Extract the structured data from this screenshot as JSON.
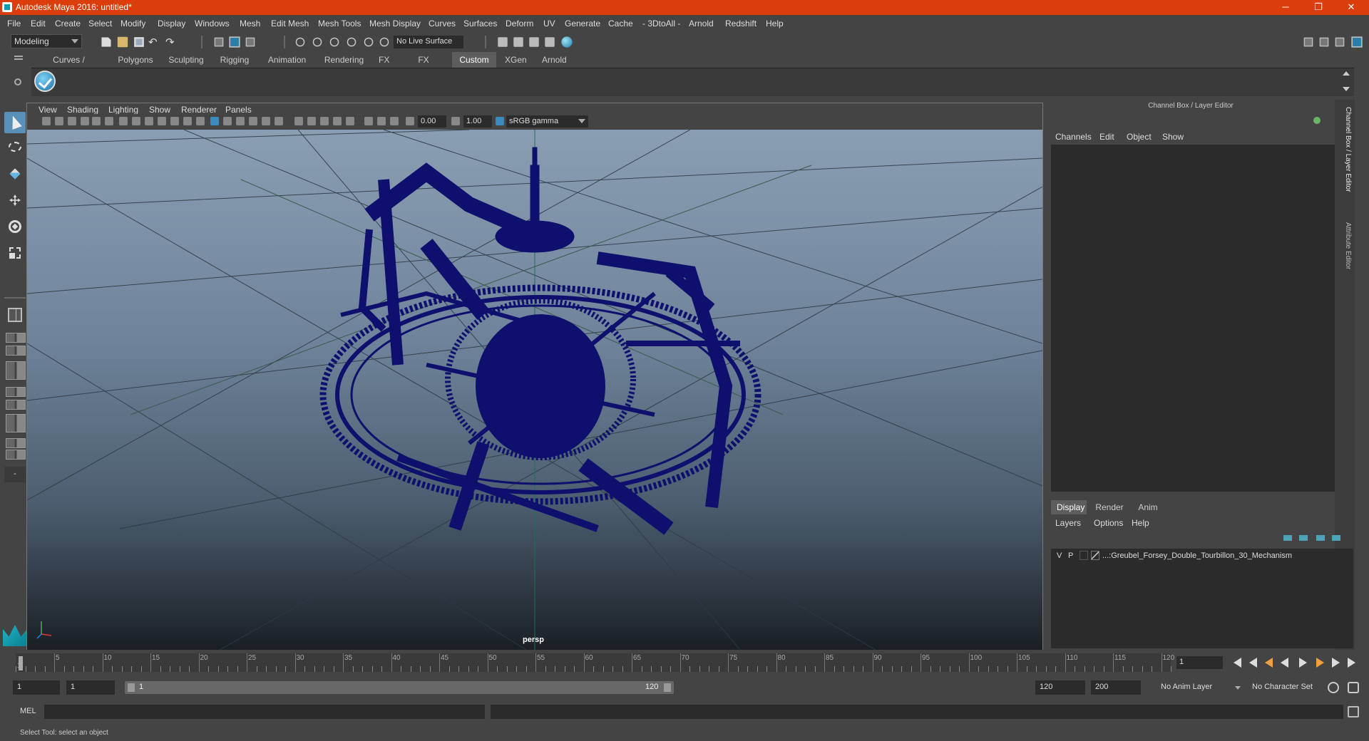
{
  "window": {
    "title": "Autodesk Maya 2016: untitled*",
    "minimize": "─",
    "restore": "❐",
    "close": "✕"
  },
  "menu": [
    "File",
    "Edit",
    "Create",
    "Select",
    "Modify",
    "Display",
    "Windows",
    "Mesh",
    "Edit Mesh",
    "Mesh Tools",
    "Mesh Display",
    "Curves",
    "Surfaces",
    "Deform",
    "UV",
    "Generate",
    "Cache",
    "- 3DtoAll -",
    "Arnold",
    "Redshift",
    "Help"
  ],
  "statusline": {
    "mode": "Modeling",
    "live_surface": "No Live Surface"
  },
  "shelf_tabs": [
    "Curves / Surfaces",
    "Polygons",
    "Sculpting",
    "Rigging",
    "Animation",
    "Rendering",
    "FX",
    "FX Caching",
    "Custom",
    "XGen",
    "Arnold"
  ],
  "shelf_active": "Custom",
  "panel_menu": [
    "View",
    "Shading",
    "Lighting",
    "Show",
    "Renderer",
    "Panels"
  ],
  "panel_toolbar": {
    "exposure": "0.00",
    "gamma_value": "1.00",
    "color_space": "sRGB gamma"
  },
  "viewport": {
    "camera_label": "persp",
    "wire_color": "#0f0f6e"
  },
  "channel_box": {
    "title": "Channel Box / Layer Editor",
    "menu": [
      "Channels",
      "Edit",
      "Object",
      "Show"
    ],
    "side_tabs": [
      "Channel Box / Layer Editor",
      "Attribute Editor"
    ]
  },
  "layer_editor": {
    "tabs": [
      "Display",
      "Render",
      "Anim"
    ],
    "active_tab": "Display",
    "menu": [
      "Layers",
      "Options",
      "Help"
    ],
    "layers": [
      {
        "v": "V",
        "p": "P",
        "name": "...:Greubel_Forsey_Double_Tourbillon_30_Mechanism"
      }
    ]
  },
  "timeslider": {
    "labels": [
      "1",
      "5",
      "10",
      "15",
      "20",
      "25",
      "30",
      "35",
      "40",
      "45",
      "50",
      "55",
      "60",
      "65",
      "70",
      "75",
      "80",
      "85",
      "90",
      "95",
      "100",
      "105",
      "110",
      "115",
      "120"
    ],
    "current_frame": "1"
  },
  "range": {
    "start": "1",
    "anim_start": "1",
    "range_start": "1",
    "range_end": "120",
    "end": "120",
    "anim_end": "200",
    "anim_layer": "No Anim Layer",
    "character_set": "No Character Set"
  },
  "command": {
    "label": "MEL"
  },
  "help_line": "Select Tool: select an object"
}
